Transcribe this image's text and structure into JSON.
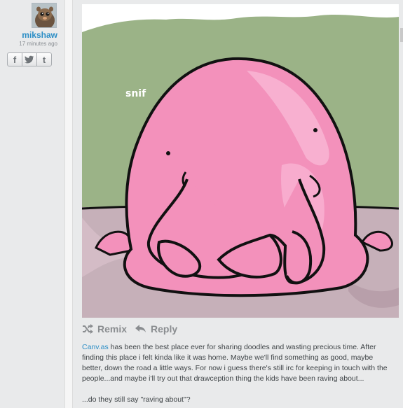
{
  "author": {
    "username": "mikshaw",
    "timestamp": "17 minutes ago",
    "avatar_icon": "hedgehog-avatar"
  },
  "share": {
    "facebook": "f",
    "twitter": "t",
    "tumblr": "t"
  },
  "drawing": {
    "label": "snif",
    "colors": {
      "background_green": "#9bb387",
      "floor": "#c6b0b9",
      "blob": "#f391bb",
      "blob_highlight": "#f9b8d6"
    }
  },
  "actions": {
    "remix_label": "Remix",
    "reply_label": "Reply"
  },
  "caption": {
    "link_text": "Canv.as",
    "paragraph1_rest": " has been the best place ever for sharing doodles and wasting precious time. After finding this place i felt kinda like it was home. Maybe we'll find something as good, maybe better, down the road a little ways. For now i guess there's still irc for keeping in touch with the people...and maybe i'll try out that drawception thing the kids have been raving about...",
    "paragraph2": "...do they still say \"raving about\"?"
  }
}
